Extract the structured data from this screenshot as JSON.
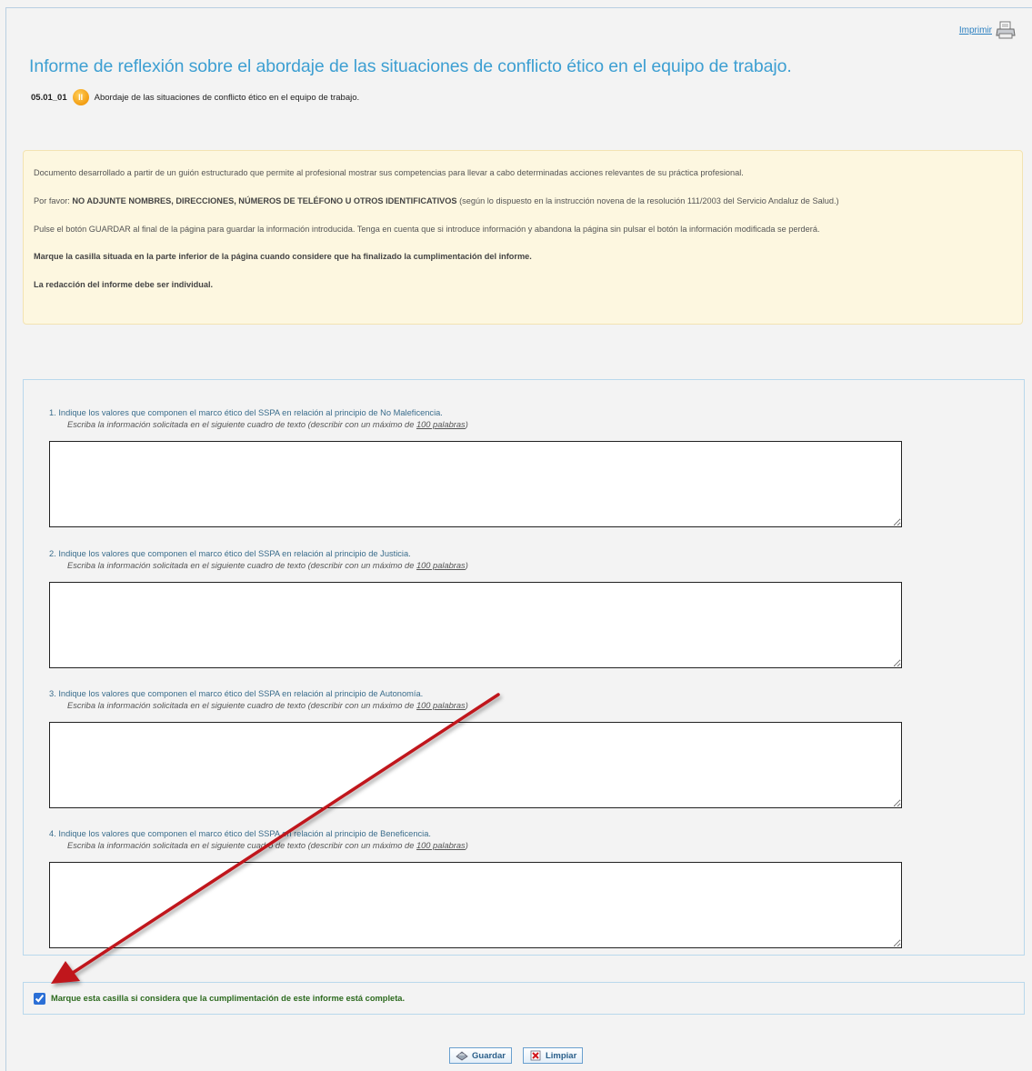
{
  "print": {
    "label": "Imprimir",
    "icon": "printer-icon"
  },
  "title": "Informe de reflexión sobre el abordaje de las situaciones de conflicto ético en el equipo de trabajo.",
  "competence": {
    "code": "05.01_01",
    "badge": "II",
    "text": "Abordaje de las situaciones de conflicto ético en el equipo de trabajo."
  },
  "info": {
    "line1": "Documento desarrollado a partir de un guión estructurado que permite al profesional mostrar sus competencias para llevar a cabo determinadas acciones relevantes de su práctica profesional.",
    "line2_prefix": "Por favor: ",
    "line2_bold": "NO ADJUNTE NOMBRES, DIRECCIONES, NÚMEROS DE TELÉFONO U OTROS IDENTIFICATIVOS",
    "line2_suffix": " (según lo dispuesto en la instrucción novena de la resolución 111/2003 del Servicio Andaluz de Salud.)",
    "line3": "Pulse el botón GUARDAR al final de la página para guardar la información introducida. Tenga en cuenta que si introduce información y abandona la página sin pulsar el botón la información modificada se perderá.",
    "line4": "Marque la casilla situada en la parte inferior de la página cuando considere que ha finalizado la cumplimentación del informe.",
    "line5": "La redacción del informe debe ser individual."
  },
  "questions": [
    {
      "label": "1. Indique los valores que componen el marco ético del SSPA en relación al principio de No Maleficencia.",
      "hint_prefix": "Escriba la información solicitada en el siguiente cuadro de texto (describir con un máximo de ",
      "hint_limit": "100 palabras",
      "hint_suffix": ")",
      "value": ""
    },
    {
      "label": "2. Indique los valores que componen el marco ético del SSPA en relación al principio de Justicia.",
      "hint_prefix": "Escriba la información solicitada en el siguiente cuadro de texto (describir con un máximo de ",
      "hint_limit": "100 palabras",
      "hint_suffix": ")",
      "value": ""
    },
    {
      "label": "3. Indique los valores que componen el marco ético del SSPA en relación al principio de Autonomía.",
      "hint_prefix": "Escriba la información solicitada en el siguiente cuadro de texto (describir con un máximo de ",
      "hint_limit": "100 palabras",
      "hint_suffix": ")",
      "value": ""
    },
    {
      "label": "4. Indique los valores que componen el marco ético del SSPA en relación al principio de Beneficencia.",
      "hint_prefix": "Escriba la información solicitada en el siguiente cuadro de texto (describir con un máximo de ",
      "hint_limit": "100 palabras",
      "hint_suffix": ")",
      "value": ""
    }
  ],
  "complete_checkbox": {
    "label": "Marque esta casilla si considera que la cumplimentación de este informe está completa.",
    "checked": true
  },
  "buttons": {
    "save": "Guardar",
    "save_icon": "save-icon",
    "clear": "Limpiar",
    "clear_icon": "clear-icon"
  },
  "colors": {
    "title": "#3d9fd2",
    "info_bg": "#fdf7e0",
    "arrow": "#c0161b",
    "checkbox_label": "#2d6a1f"
  }
}
